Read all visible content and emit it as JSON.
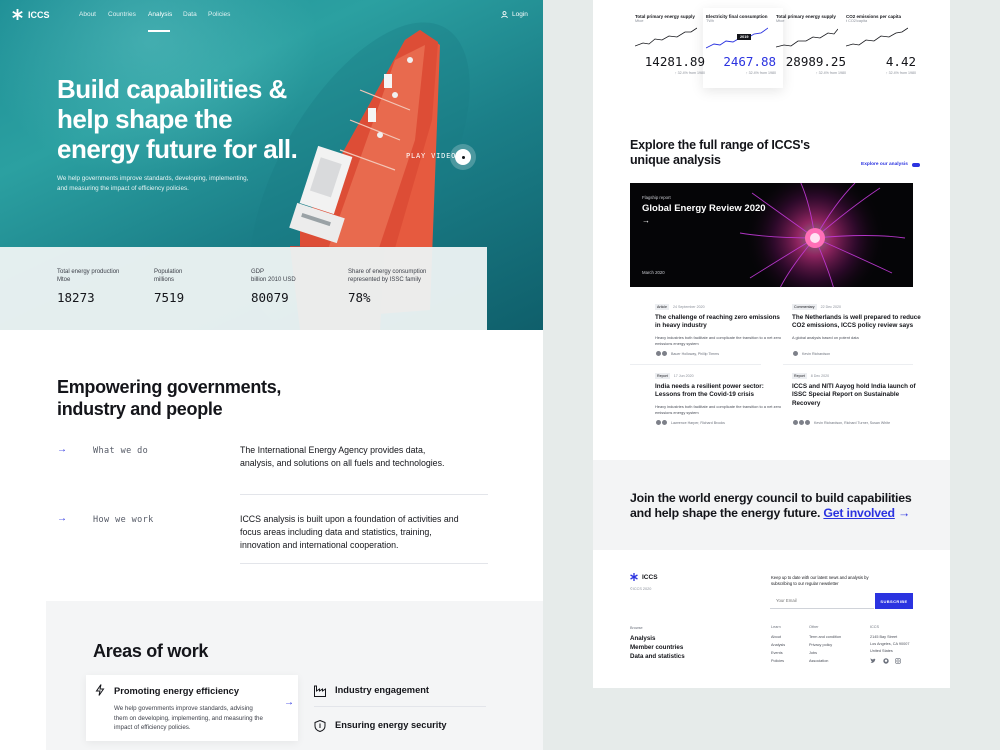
{
  "nav": {
    "brand": "ICCS",
    "links": [
      "About",
      "Countries",
      "Analysis",
      "Data",
      "Policies"
    ],
    "active": "Analysis",
    "login": "Login"
  },
  "hero": {
    "title": "Build capabilities & help shape the energy future for all.",
    "subtitle": "We help governments improve standards, developing, implementing, and measuring the impact of efficiency policies.",
    "play_label": "PLAY VIDEO"
  },
  "stats": [
    {
      "label": "Total energy production",
      "unit": "Mtoe",
      "value": "18273"
    },
    {
      "label": "Population",
      "unit": "millions",
      "value": "7519"
    },
    {
      "label": "GDP",
      "unit": "billion 2010 USD",
      "value": "80079"
    },
    {
      "label": "Share of energy consumption",
      "unit": "represented by ISSC family",
      "value": "78%"
    }
  ],
  "empowering": {
    "title": "Empowering governments, industry and people",
    "rows": [
      {
        "label": "What we do",
        "text": "The International Energy Agency provides data, analysis, and solutions on all fuels and technologies."
      },
      {
        "label": "How we work",
        "text": "ICCS analysis is built upon a foundation of activities and focus areas including data and statistics, training, innovation and international cooperation."
      }
    ]
  },
  "areas": {
    "title": "Areas of work",
    "items": [
      {
        "title": "Promoting energy efficiency",
        "desc": "We help governments improve standards, advising them on developing, implementing, and measuring the impact of efficiency policies.",
        "icon": "lightning-icon"
      },
      {
        "title": "Industry engagement",
        "icon": "factory-icon"
      },
      {
        "title": "Ensuring energy security",
        "icon": "shield-icon"
      }
    ]
  },
  "mini_stats": [
    {
      "title": "Total primary energy supply",
      "unit": "Mtoe",
      "value": "14281.89",
      "change": "↑ 32.4% from 1980"
    },
    {
      "title": "Electricity final consumption",
      "unit": "TWh",
      "value": "2467.88",
      "change": "↑ 32.4% from 1980",
      "tooltip": "2019"
    },
    {
      "title": "Total primary energy supply",
      "unit": "Mtoe",
      "value": "28989.25",
      "change": "↑ 32.4% from 1980"
    },
    {
      "title": "CO2 emissions per capita",
      "unit": "t CO2/capita",
      "value": "4.42",
      "change": "↑ 32.4% from 1980"
    }
  ],
  "explore": {
    "title": "Explore the full range of ICCS's unique analysis",
    "link": "Explore our analysis"
  },
  "feature": {
    "eyebrow": "Flagship report",
    "title": "Global Energy Review 2020",
    "date": "March 2020"
  },
  "articles": [
    {
      "tag": "Article",
      "date": "24 September 2020",
      "title": "The challenge of reaching zero emissions in heavy industry",
      "desc": "Heavy industries both facilitate and complicate the transition to a net zero emissions energy system",
      "authors": "Bauer Holloway, Phillip Timms"
    },
    {
      "tag": "Commentary",
      "date": "22 Dec 2020",
      "title": "The Netherlands is well prepared to reduce CO2 emissions, ICCS policy review says",
      "desc": "A global analysis based on potent data",
      "authors": "Kevin Richardson"
    },
    {
      "tag": "Report",
      "date": "17 Jun 2020",
      "title": "India needs a resilient power sector: Lessons from the Covid-19 crisis",
      "desc": "Heavy industries both facilitate and complicate the transition to a net zero emissions energy system",
      "authors": "Lawrence Harper, Richard Brooks"
    },
    {
      "tag": "Report",
      "date": "8 Dec 2020",
      "title": "ICCS and NITI Aayog hold India launch of ISSC Special Report on Sustainable Recovery",
      "desc": "",
      "authors": "Kevin Richardson, Richard Turner, Susan White"
    }
  ],
  "cta": {
    "text": "Join the world energy council to build capabilities and help shape the energy future.",
    "link": "Get involved"
  },
  "footer": {
    "brand": "ICCS",
    "copyright": "©ICCS 2020",
    "newsletter": "Keep up to date with our latest news and analysis by subscribing to our regular newsletter",
    "email_placeholder": "Your Email",
    "subscribe": "SUBSCRIBE",
    "browse_label": "Browse",
    "browse": [
      "Analysis",
      "Member countries",
      "Data and statistics"
    ],
    "learn_label": "Learn",
    "learn": [
      "About",
      "Analysis",
      "Events",
      "Policies"
    ],
    "other_label": "Other",
    "other": [
      "Term and condition",
      "Privacy policy",
      "Jobs",
      "Association"
    ],
    "iccs_label": "ICCS",
    "address": [
      "2145 Bay Street",
      "Los Angeles, CA 90007",
      "United States"
    ],
    "social": [
      "twitter-icon",
      "github-icon",
      "instagram-icon"
    ]
  },
  "colors": {
    "accent": "#2b33e0",
    "dark": "#14151a",
    "hero_water": "#1e8f96"
  }
}
